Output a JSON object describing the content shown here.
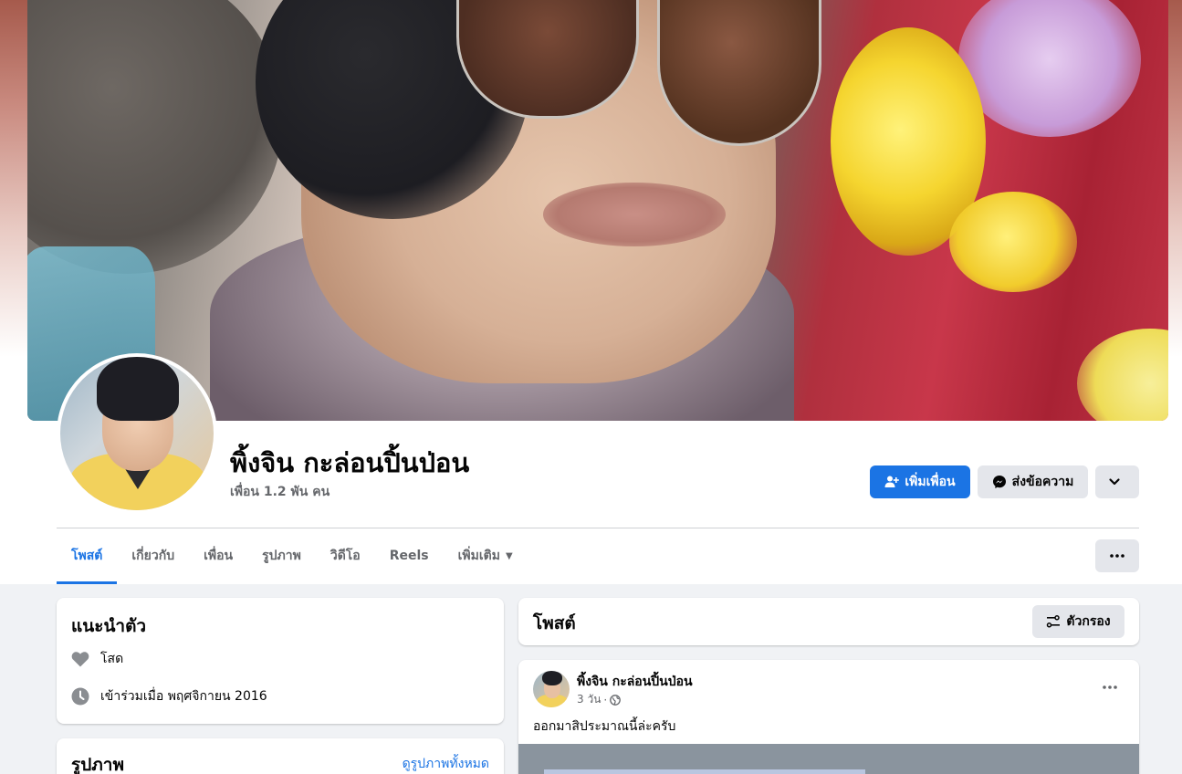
{
  "profile": {
    "name": "พิ้งจิน กะล่อนปิ้นป่อน",
    "friends": "เพื่อน 1.2 พัน คน"
  },
  "actions": {
    "add_friend": "เพิ่มเพื่อน",
    "message": "ส่งข้อความ"
  },
  "tabs": [
    {
      "label": "โพสต์",
      "active": true
    },
    {
      "label": "เกี่ยวกับ"
    },
    {
      "label": "เพื่อน"
    },
    {
      "label": "รูปภาพ"
    },
    {
      "label": "วิดีโอ"
    },
    {
      "label": "Reels"
    },
    {
      "label": "เพิ่มเติม"
    }
  ],
  "intro": {
    "title": "แนะนำตัว",
    "relationship": "โสด",
    "joined": "เข้าร่วมเมื่อ พฤศจิกายน 2016"
  },
  "photos": {
    "title": "รูปภาพ",
    "see_all": "ดูรูปภาพทั้งหมด"
  },
  "posts": {
    "title": "โพสต์",
    "filter": "ตัวกรอง"
  },
  "post": {
    "author": "พิ้งจิน กะล่อนปิ้นป่อน",
    "time": "3 วัน",
    "text": "ออกมาสิประมาณนี้ล่ะครับ"
  },
  "colors": {
    "accent": "#1b74e4",
    "secondary_button": "#e4e6eb",
    "background": "#f0f2f5",
    "muted_text": "#65676b"
  },
  "icons": [
    "add-friend-icon",
    "messenger-icon",
    "chevron-down-icon",
    "more-dots-icon",
    "heart-icon",
    "clock-icon",
    "filter-icon",
    "globe-icon"
  ]
}
